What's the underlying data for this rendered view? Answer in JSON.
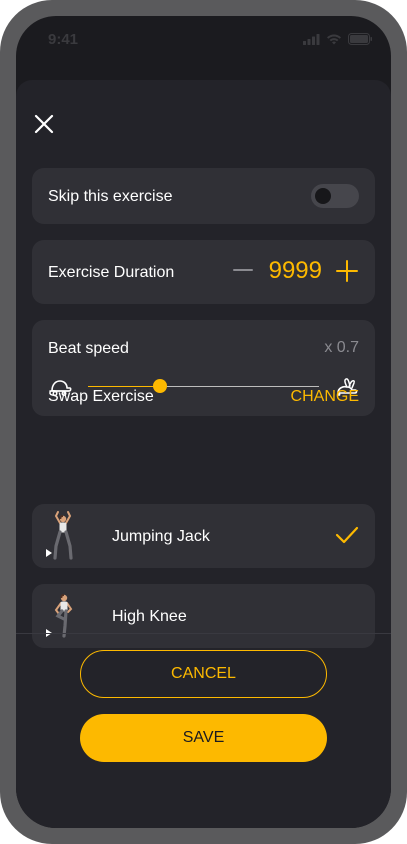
{
  "status_bar": {
    "time": "9:41"
  },
  "skip": {
    "label": "Skip this exercise",
    "enabled": false
  },
  "duration": {
    "label": "Exercise Duration",
    "value": "9999"
  },
  "beat_speed": {
    "label": "Beat speed",
    "value": "x 0.7",
    "slider_fraction": 0.31
  },
  "swap": {
    "title": "Swap Exercise",
    "change_label": "CHANGE",
    "exercises": [
      {
        "name": "Jumping Jack",
        "selected": true
      },
      {
        "name": "High Knee",
        "selected": false
      }
    ]
  },
  "actions": {
    "cancel_label": "CANCEL",
    "save_label": "SAVE"
  },
  "colors": {
    "accent": "#fdb900",
    "background": "#1b1b1f",
    "sheet": "#232329",
    "card": "#303036"
  },
  "icons": [
    "close-icon",
    "turtle-icon",
    "rabbit-icon",
    "minus-icon",
    "plus-icon",
    "checkmark-icon",
    "play-icon"
  ]
}
